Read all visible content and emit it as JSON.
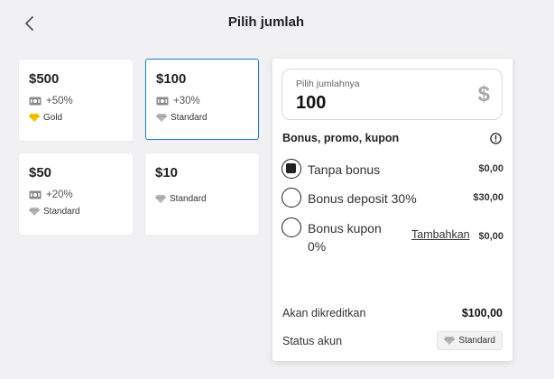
{
  "header": {
    "title": "Pilih jumlah"
  },
  "cards": [
    {
      "amount": "$500",
      "bonus": "+50%",
      "status": "Gold"
    },
    {
      "amount": "$100",
      "bonus": "+30%",
      "status": "Standard"
    },
    {
      "amount": "$50",
      "bonus": "+20%",
      "status": "Standard"
    },
    {
      "amount": "$10",
      "status": "Standard"
    }
  ],
  "panel": {
    "amount_label": "Pilih jumlahnya",
    "amount_value": "100",
    "currency_symbol": "$",
    "section_title": "Bonus, promo, kupon",
    "options": [
      {
        "label": "Tanpa bonus",
        "value": "$0,00",
        "selected": true
      },
      {
        "label": "Bonus deposit 30%",
        "value": "$30,00",
        "selected": false
      },
      {
        "label_line1": "Bonus kupon",
        "label_line2": "0%",
        "link": "Tambahkan",
        "value": "$0,00",
        "selected": false
      }
    ],
    "credited_label": "Akan dikreditkan",
    "credited_value": "$100,00",
    "account_status_label": "Status akun",
    "account_status": "Standard"
  },
  "icons": {
    "back": "chevron-left-icon",
    "ticket": "ticket-icon",
    "gold": "gold-gem-icon",
    "standard": "diamond-icon",
    "currency": "dollar-icon",
    "info": "info-icon"
  },
  "colors": {
    "accent": "#1f7fc6",
    "gold": "#f2c400",
    "background": "#f1f1f3"
  }
}
